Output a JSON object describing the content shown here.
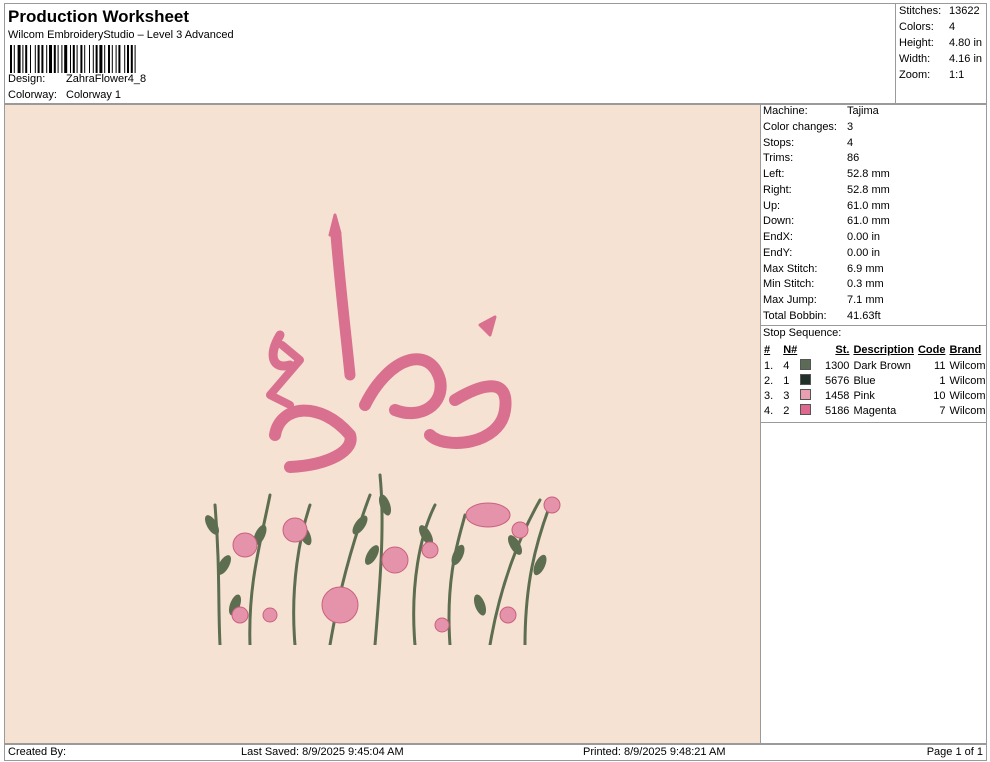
{
  "header": {
    "title": "Production Worksheet",
    "subtitle": "Wilcom EmbroideryStudio – Level 3 Advanced",
    "design_label": "Design:",
    "design_value": "ZahraFlower4_8",
    "colorway_label": "Colorway:",
    "colorway_value": "Colorway 1"
  },
  "stats": [
    {
      "label": "Stitches:",
      "value": "13622"
    },
    {
      "label": "Colors:",
      "value": "4"
    },
    {
      "label": "Height:",
      "value": "4.80 in"
    },
    {
      "label": "Width:",
      "value": "4.16 in"
    },
    {
      "label": "Zoom:",
      "value": "1:1"
    }
  ],
  "info": [
    {
      "label": "Machine:",
      "value": "Tajima"
    },
    {
      "label": "Color changes:",
      "value": "3"
    },
    {
      "label": "Stops:",
      "value": "4"
    },
    {
      "label": "Trims:",
      "value": "86"
    },
    {
      "label": "Left:",
      "value": "52.8 mm"
    },
    {
      "label": "Right:",
      "value": "52.8 mm"
    },
    {
      "label": "Up:",
      "value": "61.0 mm"
    },
    {
      "label": "Down:",
      "value": "61.0 mm"
    },
    {
      "label": "EndX:",
      "value": "0.00 in"
    },
    {
      "label": "EndY:",
      "value": "0.00 in"
    },
    {
      "label": "Max Stitch:",
      "value": "6.9 mm"
    },
    {
      "label": "Min Stitch:",
      "value": "0.3 mm"
    },
    {
      "label": "Max Jump:",
      "value": "7.1 mm"
    },
    {
      "label": "Total Bobbin:",
      "value": "41.63ft"
    }
  ],
  "stop_sequence": {
    "title": "Stop Sequence:",
    "headers": [
      "#",
      "N#",
      "St.",
      "Description",
      "Code",
      "Brand"
    ],
    "rows": [
      {
        "num": "1.",
        "n": "4",
        "st": "1300",
        "description": "Dark Brown",
        "code": "11",
        "brand": "Wilcom",
        "color": "#5c6b55"
      },
      {
        "num": "2.",
        "n": "1",
        "st": "5676",
        "description": "Blue",
        "code": "1",
        "brand": "Wilcom",
        "color": "#22302a"
      },
      {
        "num": "3.",
        "n": "3",
        "st": "1458",
        "description": "Pink",
        "code": "10",
        "brand": "Wilcom",
        "color": "#e8a0b0"
      },
      {
        "num": "4.",
        "n": "2",
        "st": "5186",
        "description": "Magenta",
        "code": "7",
        "brand": "Wilcom",
        "color": "#e0678e"
      }
    ]
  },
  "footer": {
    "created_by": "Created By:",
    "last_saved": "Last Saved: 8/9/2025 9:45:04 AM",
    "printed": "Printed: 8/9/2025 9:48:21 AM",
    "page": "Page 1 of 1"
  },
  "colors": {
    "canvas_bg": "#f6e2d3",
    "text_pink": "#d9708f",
    "leaf_green": "#5d6e50",
    "flower_pink": "#e592ab"
  }
}
